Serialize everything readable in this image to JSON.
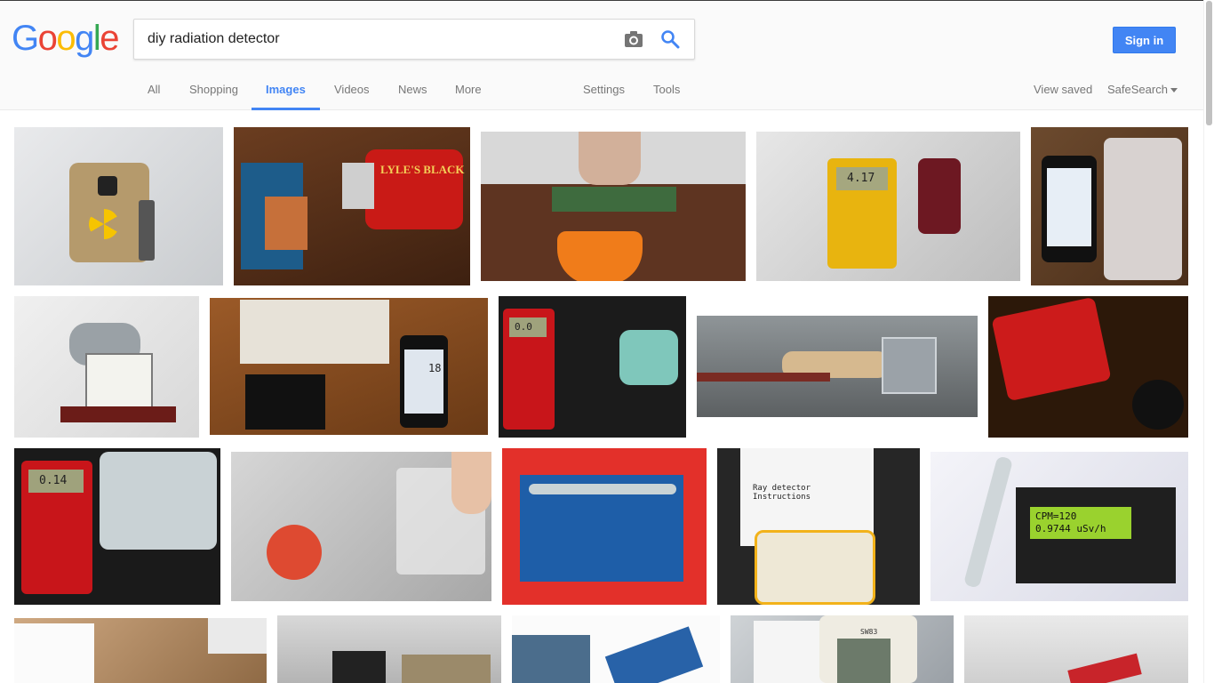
{
  "logo": {
    "letters": [
      "G",
      "o",
      "o",
      "g",
      "l",
      "e"
    ],
    "colors": [
      "#4285F4",
      "#EA4335",
      "#FBBC05",
      "#4285F4",
      "#34A853",
      "#EA4335"
    ]
  },
  "search": {
    "query": "diy radiation detector"
  },
  "header": {
    "signin_label": "Sign in"
  },
  "tabs": [
    {
      "label": "All"
    },
    {
      "label": "Shopping"
    },
    {
      "label": "Images",
      "active": true
    },
    {
      "label": "Videos"
    },
    {
      "label": "News"
    },
    {
      "label": "More"
    },
    {
      "label": "Settings"
    },
    {
      "label": "Tools"
    }
  ],
  "right_links": {
    "view_saved": "View saved",
    "safesearch": "SafeSearch"
  },
  "thumb_text": {
    "lyles": "LYLE'S BLACK",
    "meter1": "4.17",
    "iphone18": "18",
    "meter2": "0.0",
    "meter3": "0.14",
    "lcd1": "CPM=120",
    "lcd2": "0.9744 uSv/h",
    "paper": "Ray detector Instructions",
    "sw": "SW83"
  },
  "colors": {
    "accent": "#4285f4",
    "header_bg": "#fafafa",
    "tab_text": "#777777"
  }
}
